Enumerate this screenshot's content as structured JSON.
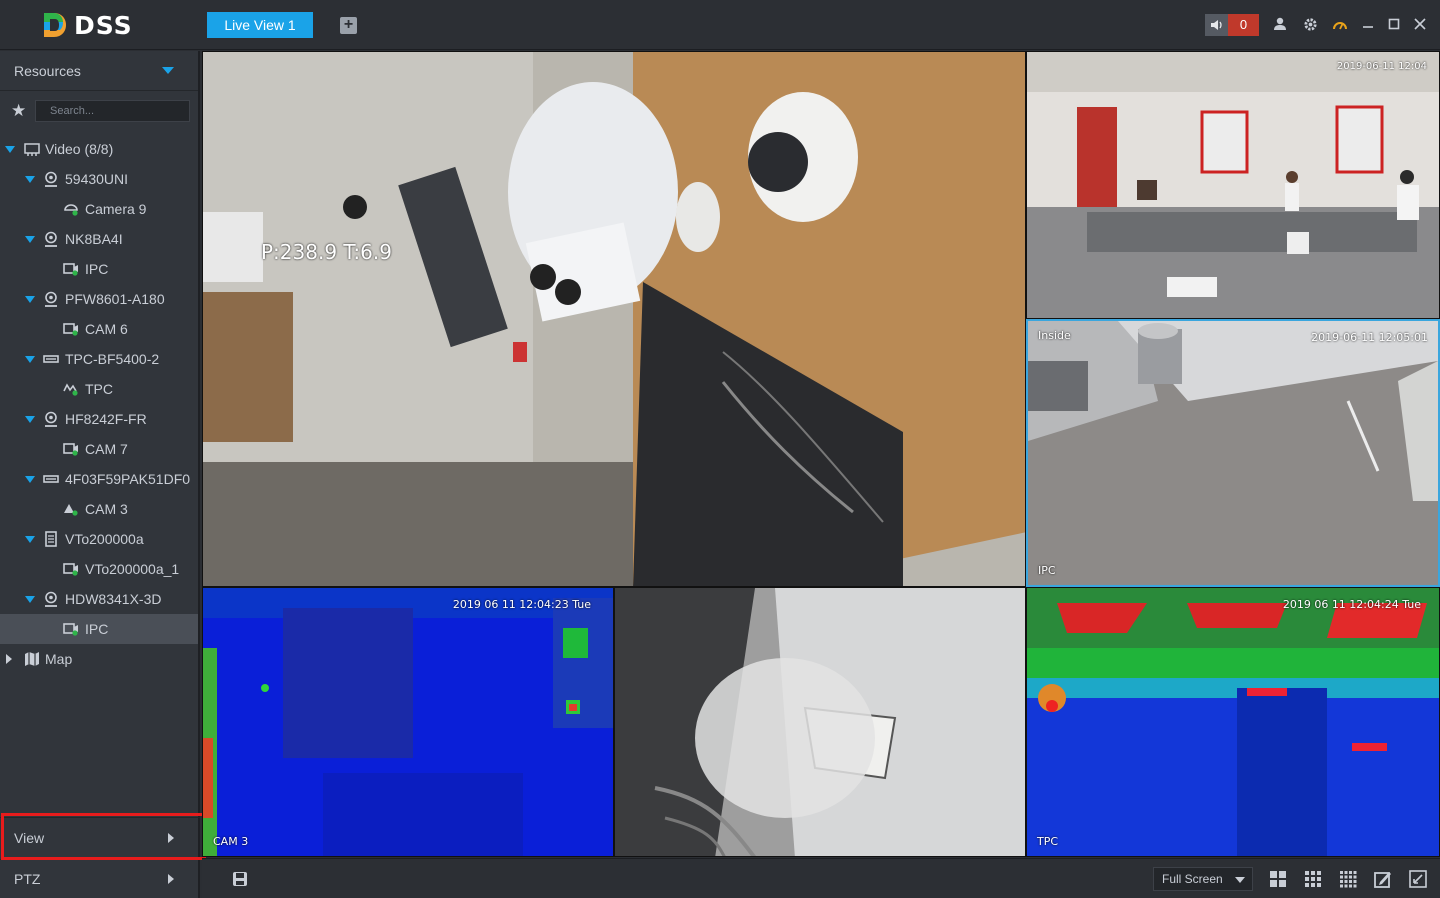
{
  "app": {
    "logo_text": "DSS"
  },
  "header": {
    "tab_label": "Live View 1",
    "add_tab_icon": "plus-icon",
    "alarm_count": "0"
  },
  "sidebar": {
    "resources_label": "Resources",
    "search_placeholder": "Search...",
    "tree": [
      {
        "label": "Video (8/8)",
        "icon": "video-icon"
      },
      {
        "label": "59430UNI",
        "icon": "nvr-icon"
      },
      {
        "label": "Camera 9",
        "icon": "camera-icon"
      },
      {
        "label": "NK8BA4I",
        "icon": "nvr-icon"
      },
      {
        "label": "IPC",
        "icon": "camera-icon"
      },
      {
        "label": "PFW8601-A180",
        "icon": "nvr-icon"
      },
      {
        "label": "CAM 6",
        "icon": "camera-icon"
      },
      {
        "label": "TPC-BF5400-2",
        "icon": "dvr-icon"
      },
      {
        "label": "TPC",
        "icon": "thermal-icon"
      },
      {
        "label": "HF8242F-FR",
        "icon": "nvr-icon"
      },
      {
        "label": "CAM 7",
        "icon": "camera-icon"
      },
      {
        "label": "4F03F59PAK51DF0",
        "icon": "dvr-icon"
      },
      {
        "label": "CAM 3",
        "icon": "alarm-camera-icon"
      },
      {
        "label": "VTo200000a",
        "icon": "door-station-icon"
      },
      {
        "label": "VTo200000a_1",
        "icon": "camera-icon"
      },
      {
        "label": "HDW8341X-3D",
        "icon": "nvr-icon"
      },
      {
        "label": "IPC",
        "icon": "camera-icon"
      },
      {
        "label": "Map",
        "icon": "map-icon"
      }
    ],
    "view_label": "View",
    "ptz_label": "PTZ"
  },
  "panes": {
    "p1": {
      "osd": "P:238.9 T:6.9"
    },
    "p2": {
      "osd_time": "2019-06-11 12:04"
    },
    "p3": {
      "osd_name": "Inside",
      "osd_time": "2019-06-11 12:05:01",
      "osd_bottom": "IPC"
    },
    "p4": {
      "osd_time": "2019 06 11 12:04:23 Tue",
      "osd_bottom": "CAM 3"
    },
    "p6": {
      "osd_time": "2019 06 11 12:04:24 Tue",
      "osd_bottom": "TPC"
    }
  },
  "bottombar": {
    "fullscreen_label": "Full Screen"
  },
  "colors": {
    "accent": "#1aa3e8",
    "alarm": "#c0392b",
    "highlight": "#e81c1c"
  }
}
